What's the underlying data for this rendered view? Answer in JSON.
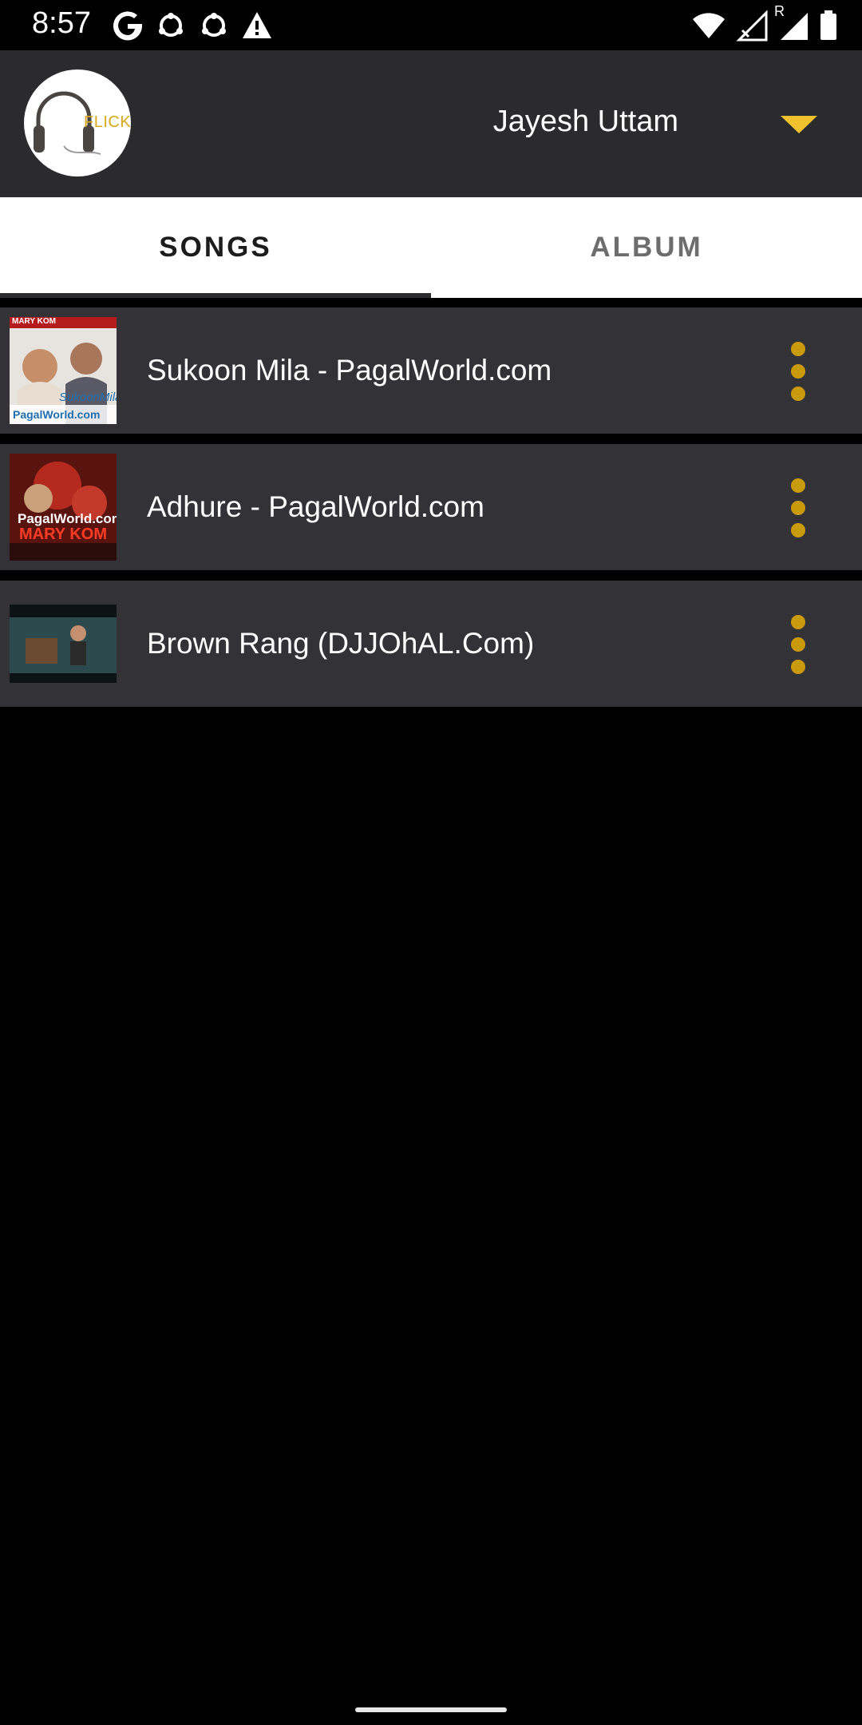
{
  "status_bar": {
    "time": "8:57",
    "left_icons": [
      "google-icon",
      "sync-icon",
      "sync-icon",
      "warning-icon"
    ],
    "right_icons": [
      "wifi-icon",
      "signal-icon",
      "roaming-signal-icon",
      "battery-icon"
    ],
    "roaming_label": "R"
  },
  "header": {
    "logo_text": "FLICKR",
    "user_name": "Jayesh Uttam",
    "accent_color": "#f2c12e"
  },
  "tabs": [
    {
      "label": "SONGS",
      "selected": true
    },
    {
      "label": "ALBUM",
      "selected": false
    }
  ],
  "songs": [
    {
      "title": "Sukoon Mila - PagalWorld.com",
      "thumb_caption": "SukoonMila",
      "thumb_site": "PagalWorld.com",
      "thumb_header": "MARY KOM"
    },
    {
      "title": "Adhure - PagalWorld.com",
      "thumb_caption": "MARY KOM",
      "thumb_site": "PagalWorld.com"
    },
    {
      "title": "Brown Rang (DJJOhAL.Com)"
    }
  ],
  "colors": {
    "header_bg": "#2b2b2d",
    "row_bg": "#333237",
    "menu_dots": "#c99a0c",
    "caret": "#f2c12e"
  }
}
